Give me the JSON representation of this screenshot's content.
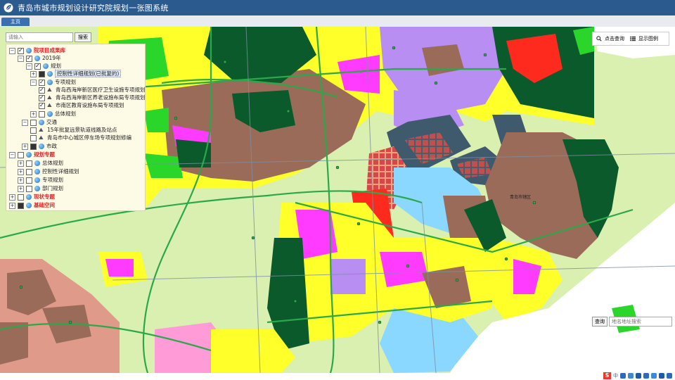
{
  "app": {
    "title": "青岛市城市规划设计研究院规划一张图系统"
  },
  "tabs": [
    {
      "label": "主页"
    }
  ],
  "search": {
    "placeholder": "请输入",
    "button_label": "搜索"
  },
  "toolbar": {
    "click_query_label": "点击查询",
    "show_legend_label": "显示图例"
  },
  "address_search": {
    "button_label": "查询",
    "placeholder": "地名地址搜索"
  },
  "map_labels": {
    "district_label": "青岛市辖区"
  },
  "tree": {
    "root": "院项目成果库",
    "year": "2019年",
    "planning": "规划",
    "control_detail": "控制性详细规划(已批复的)",
    "special": "专项规划",
    "special_items": [
      "青岛西海岸新区医疗卫生设施专项规划",
      "青岛西海岸新区养老设施布局专项规划",
      "市南区教育设施布局专项规划"
    ],
    "master": "总体规划",
    "traffic": "交通",
    "traffic_items": [
      "15年批复远景轨道线路及站点",
      "青岛市中心城区停车场专项规划修编"
    ],
    "municipal": "市政",
    "topics": "规划专题",
    "topic_items": [
      "总体规划",
      "控制性详细规划",
      "专项规划",
      "部门规划"
    ],
    "status_topic": "现状专题",
    "base_space": "基础空间"
  },
  "tray": {
    "brand": "S",
    "lang": "中"
  },
  "colors": {
    "title_bg": "#2b5a8f",
    "residential": "#ffff2a",
    "commercial": "#ff2a1e",
    "public": "#ff3bff",
    "industrial": "#9b6b5a",
    "green": "#2bd62b",
    "forest": "#0a5a2b",
    "water": "#8ad8ff",
    "port": "#3f5a6d",
    "purple": "#b98ef3"
  }
}
